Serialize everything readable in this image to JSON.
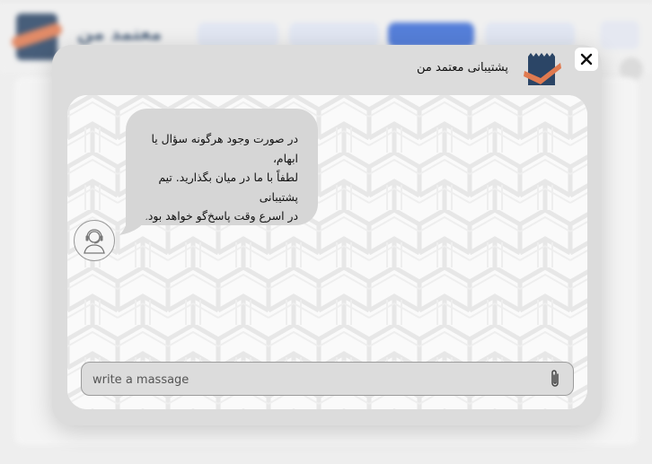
{
  "background": {
    "brand": "معتمد من"
  },
  "dialog": {
    "title": "پشتیبانی معتمد من",
    "message_lines": [
      "در صورت وجود هرگونه سؤال یا ابهام،",
      "لطفاً با ما در میان بگذارید. تیم پشتیبانی",
      "در اسرع وقت پاسخ‌گو خواهد بود."
    ],
    "input_placeholder": "write a massage",
    "close_icon": "close-icon",
    "attach_icon": "paperclip-icon",
    "agent_icon": "support-agent-icon"
  },
  "colors": {
    "dialog_bg": "#dcdcdc",
    "bubble_bg": "#d6d6d6",
    "logo_navy": "#2b4566",
    "logo_orange": "#e07a50"
  }
}
